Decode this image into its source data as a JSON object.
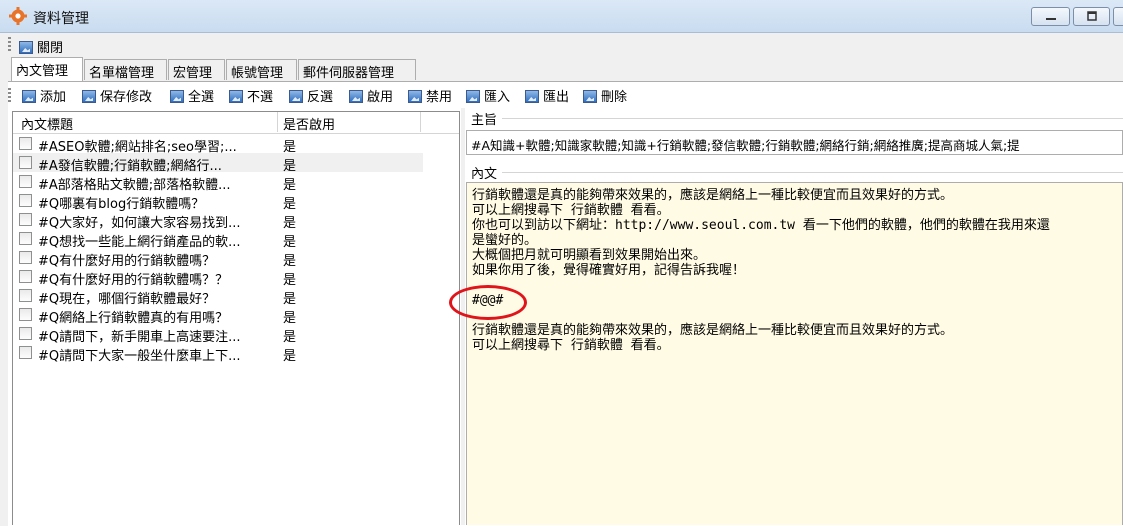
{
  "window": {
    "title": "資料管理"
  },
  "menubar": {
    "close_label": "關閉"
  },
  "tabs": [
    "內文管理",
    "名單檔管理",
    "宏管理",
    "帳號管理",
    "郵件伺服器管理"
  ],
  "toolbar": [
    "添加",
    "保存修改",
    "全選",
    "不選",
    "反選",
    "啟用",
    "禁用",
    "匯入",
    "匯出",
    "刪除"
  ],
  "list": {
    "headers": {
      "title": "內文標題",
      "enabled": "是否啟用"
    },
    "rows": [
      {
        "title": "#ASEO軟體;網站排名;seo學習;...",
        "enabled": "是"
      },
      {
        "title": "#A發信軟體;行銷軟體;網絡行...",
        "enabled": "是"
      },
      {
        "title": "#A部落格貼文軟體;部落格軟體...",
        "enabled": "是"
      },
      {
        "title": "#Q哪裏有blog行銷軟體嗎？",
        "enabled": "是"
      },
      {
        "title": "#Q大家好，如何讓大家容易找到...",
        "enabled": "是"
      },
      {
        "title": "#Q想找一些能上網行銷產品的軟...",
        "enabled": "是"
      },
      {
        "title": "#Q有什麼好用的行銷軟體嗎？",
        "enabled": "是"
      },
      {
        "title": "#Q有什麼好用的行銷軟體嗎？？",
        "enabled": "是"
      },
      {
        "title": "#Q現在，哪個行銷軟體最好？",
        "enabled": "是"
      },
      {
        "title": "#Q網絡上行銷軟體真的有用嗎？",
        "enabled": "是"
      },
      {
        "title": "#Q請問下，新手開車上高速要注...",
        "enabled": "是"
      },
      {
        "title": "#Q請問下大家一般坐什麼車上下...",
        "enabled": "是"
      }
    ]
  },
  "subject": {
    "label": "主旨",
    "value": "#A知識+軟體;知識家軟體;知識+行銷軟體;發信軟體;行銷軟體;網絡行銷;網絡推廣;提高商城人氣;提"
  },
  "content": {
    "label": "內文",
    "lines": [
      "行銷軟體還是真的能夠帶來效果的，應該是網絡上一種比較便宜而且效果好的方式。",
      "可以上網搜尋下 行銷軟體 看看。",
      "你也可以到訪以下網址：http://www.seoul.com.tw  看一下他們的軟體，他們的軟體在我用來還",
      "是蠻好的。",
      "大概個把月就可明顯看到效果開始出來。",
      "如果你用了後，覺得確實好用，記得告訴我喔！",
      "",
      "#@@#",
      "",
      "行銷軟體還是真的能夠帶來效果的，應該是網絡上一種比較便宜而且效果好的方式。",
      "可以上網搜尋下 行銷軟體 看看。"
    ]
  },
  "colors": {
    "highlight_circle": "#e0141b",
    "content_bg": "#fffbe5"
  }
}
